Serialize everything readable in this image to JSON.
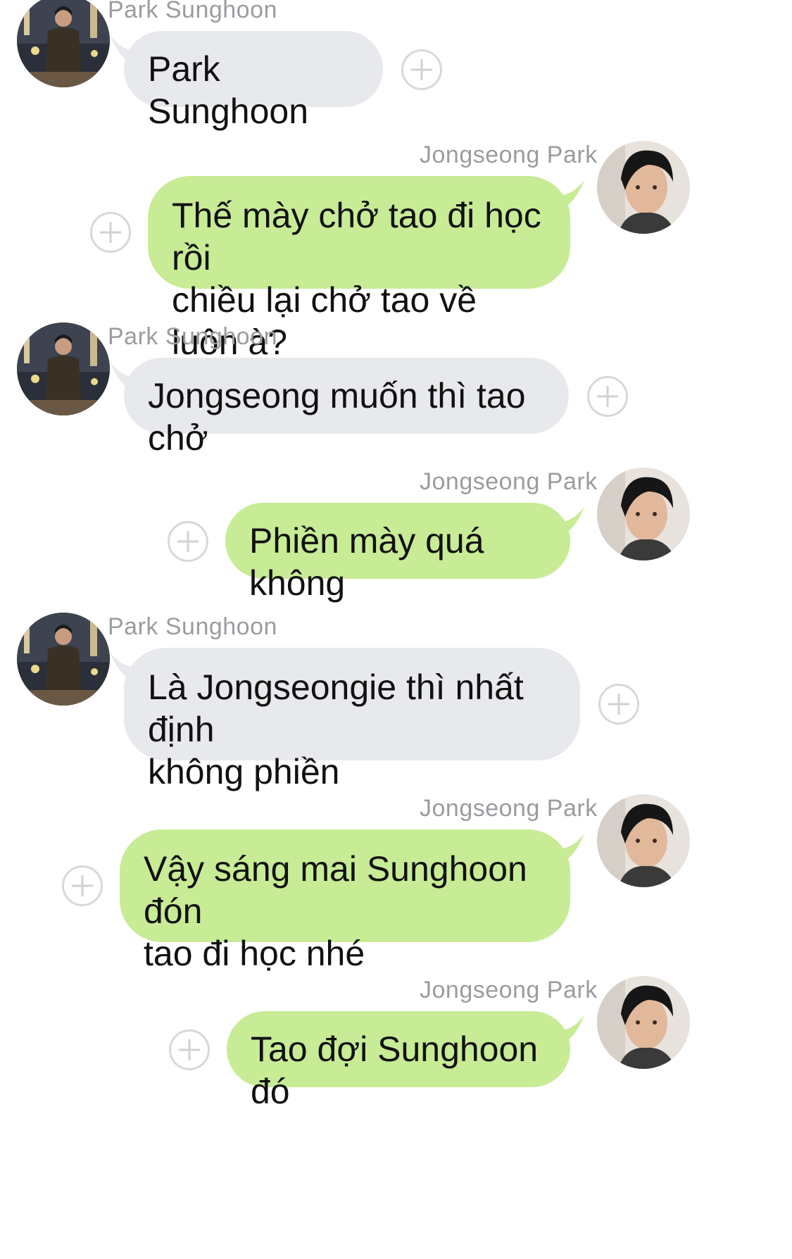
{
  "senders": {
    "sunghoon": "Park Sunghoon",
    "jongseong": "Jongseong Park"
  },
  "messages": [
    {
      "from": "sunghoon",
      "sender": "Park Sunghoon",
      "text": "Park Sunghoon"
    },
    {
      "from": "jongseong",
      "sender": "Jongseong Park",
      "text": "Thế mày chở tao đi học rồi\nchiều lại chở tao về luôn à?"
    },
    {
      "from": "sunghoon",
      "sender": "Park Sunghoon",
      "text": "Jongseong muốn thì tao chở"
    },
    {
      "from": "jongseong",
      "sender": "Jongseong Park",
      "text": "Phiền mày quá không"
    },
    {
      "from": "sunghoon",
      "sender": "Park Sunghoon",
      "text": "Là Jongseongie thì nhất định\nkhông phiền"
    },
    {
      "from": "jongseong",
      "sender": "Jongseong Park",
      "text": "Vậy sáng mai Sunghoon đón\ntao đi học nhé"
    },
    {
      "from": "jongseong",
      "sender": "Jongseong Park",
      "text": "Tao đợi Sunghoon đó"
    }
  ],
  "icons": {
    "add_button": "plus-circle-icon",
    "avatar": "avatar"
  },
  "colors": {
    "incoming_bubble": "#e7e9ec",
    "outgoing_bubble": "#c8eb96",
    "sender_name": "#9a9ca0",
    "add_icon": "#d6d8db"
  }
}
